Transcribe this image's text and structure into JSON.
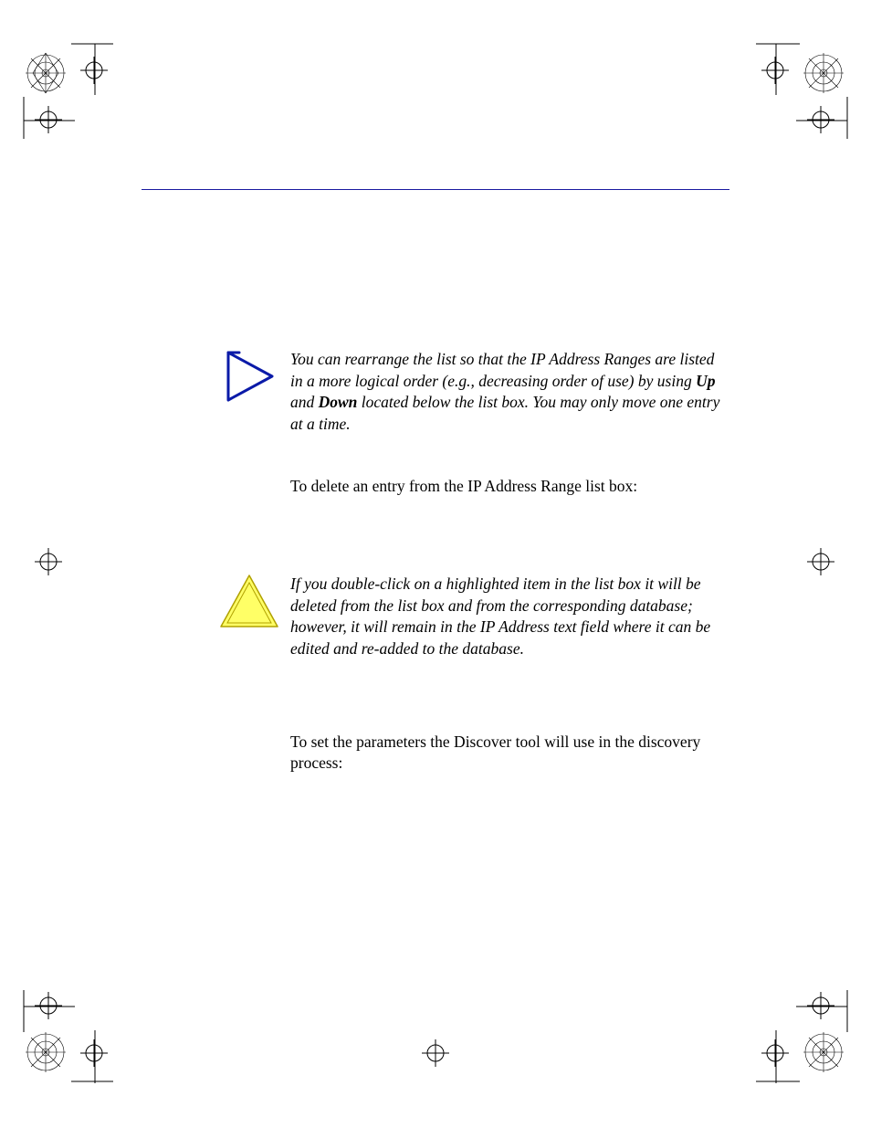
{
  "tip": {
    "line1_pre": "You can rearrange the list so that the IP Address Ranges are listed in a more logical order (e.g., decreasing order of use) by using ",
    "up": "Up",
    "mid": " and ",
    "down": "Down",
    "line1_post": " located below the list box. You may only move one entry at a time."
  },
  "delete_intro": "To delete an entry from the IP Address Range list box:",
  "caution": "If you double-click on a highlighted item in the list box it will be deleted from the list box and from the corresponding database; however, it will remain in the IP Address text field where it can be edited and re-added to the database.",
  "set_params": "To set the parameters the Discover tool will use in the discovery process:"
}
